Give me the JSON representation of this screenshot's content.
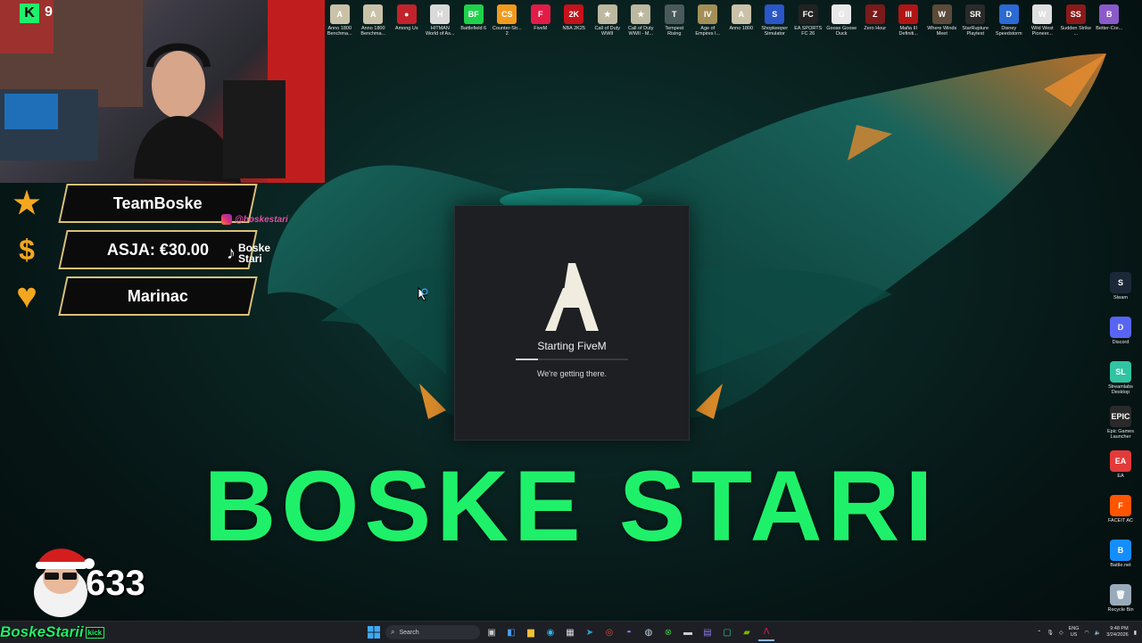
{
  "overlay": {
    "big_title": "BOSKE STARI",
    "viewer_count": "633",
    "channel_name": "BoskeStarii",
    "channel_platform": "kick",
    "kick_badge": "K",
    "kick_count": "9",
    "instagram_handle": "@boskestari",
    "tiktok_name": "Boske Stari",
    "accent": "#1ff06a"
  },
  "alerts": [
    {
      "icon": "star-icon",
      "text": "TeamBoske",
      "color": "#f4a71e"
    },
    {
      "icon": "dollar-icon",
      "text": "ASJA: €30.00",
      "color": "#f4a71e"
    },
    {
      "icon": "heart-icon",
      "text": "Marinac",
      "color": "#f4a71e"
    }
  ],
  "desktop_icons": [
    {
      "label": "Anno 1800 Benchma...",
      "color": "#c9c2a8",
      "glyph": "A"
    },
    {
      "label": "Anno 1800 Benchma...",
      "color": "#c9c2a8",
      "glyph": "A"
    },
    {
      "label": "Among Us",
      "color": "#c4222a",
      "glyph": "●"
    },
    {
      "label": "HITMAN World of As...",
      "color": "#d9d9d9",
      "glyph": "H"
    },
    {
      "label": "Battlefield 6",
      "color": "#1fd14a",
      "glyph": "BF"
    },
    {
      "label": "Counter-Str... 2",
      "color": "#f29a1d",
      "glyph": "CS"
    },
    {
      "label": "FiveM",
      "color": "#e21c46",
      "glyph": "F"
    },
    {
      "label": "NBA 2K25",
      "color": "#c4131b",
      "glyph": "2K"
    },
    {
      "label": "Call of Duty WWII",
      "color": "#bdb8a0",
      "glyph": "★"
    },
    {
      "label": "Call of Duty WWII - M...",
      "color": "#bdb8a0",
      "glyph": "★"
    },
    {
      "label": "Tempest Rising",
      "color": "#4a5a5a",
      "glyph": "T"
    },
    {
      "label": "Age of Empires I...",
      "color": "#a38f57",
      "glyph": "IV"
    },
    {
      "label": "Anno 1800",
      "color": "#c9c2a8",
      "glyph": "A"
    },
    {
      "label": "Shopkeeper Simulator",
      "color": "#2a56c9",
      "glyph": "S"
    },
    {
      "label": "EA SPORTS FC 26",
      "color": "#222",
      "glyph": "FC"
    },
    {
      "label": "Goose Goose Duck",
      "color": "#e8e8e8",
      "glyph": "G"
    },
    {
      "label": "Zero Hour",
      "color": "#7a1a1a",
      "glyph": "Z"
    },
    {
      "label": "Mafia III Definiti...",
      "color": "#b01515",
      "glyph": "III"
    },
    {
      "label": "Where Winds Meet",
      "color": "#5c4a3a",
      "glyph": "W"
    },
    {
      "label": "StarRupture Playtest",
      "color": "#2a2a2a",
      "glyph": "SR"
    },
    {
      "label": "Disney Speedstorm",
      "color": "#2a6ad4",
      "glyph": "D"
    },
    {
      "label": "Wild West Pioneer...",
      "color": "#e0e0e0",
      "glyph": "W"
    },
    {
      "label": "Sudden Strike ...",
      "color": "#8a1a1a",
      "glyph": "SS"
    },
    {
      "label": "Better-Cre...",
      "color": "#8a5ac9",
      "glyph": "B"
    }
  ],
  "right_icons": [
    {
      "label": "Steam",
      "color": "#1b2838",
      "glyph": "S"
    },
    {
      "label": "Discord",
      "color": "#5865f2",
      "glyph": "D"
    },
    {
      "label": "Streamlabs Desktop",
      "color": "#31c3a2",
      "glyph": "SL"
    },
    {
      "label": "Epic Games Launcher",
      "color": "#2a2a2a",
      "glyph": "EPIC"
    },
    {
      "label": "EA",
      "color": "#e23b3b",
      "glyph": "EA"
    },
    {
      "label": "FACEIT AC",
      "color": "#ff5500",
      "glyph": "F"
    },
    {
      "label": "Battle.net",
      "color": "#148eff",
      "glyph": "B"
    },
    {
      "label": "Recycle Bin",
      "color": "#9ab",
      "glyph": "🗑"
    }
  ],
  "dialog": {
    "title": "Starting FiveM",
    "subtitle": "We're getting there.",
    "progress": 0.2
  },
  "taskbar": {
    "search_placeholder": "Search",
    "language_line1": "ENG",
    "language_line2": "US",
    "time": "9:48 PM",
    "date": "3/24/2026"
  }
}
